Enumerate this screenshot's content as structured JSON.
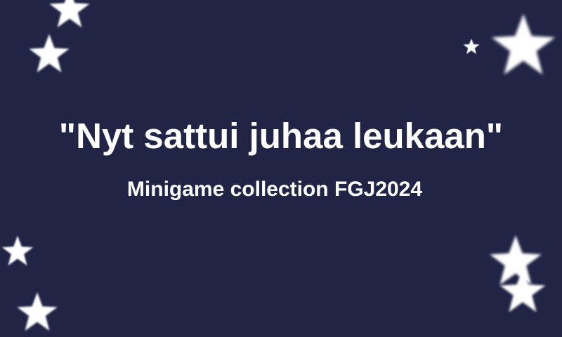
{
  "screen": {
    "title": "\"Nyt sattui juhaa leukaan\"",
    "subtitle": "Minigame collection FGJ2024"
  },
  "colors": {
    "background": "#222446",
    "text": "#ffffff",
    "stars": "#ffffff"
  },
  "decorations": {
    "star_icon": "star-icon",
    "star_count": 9
  }
}
